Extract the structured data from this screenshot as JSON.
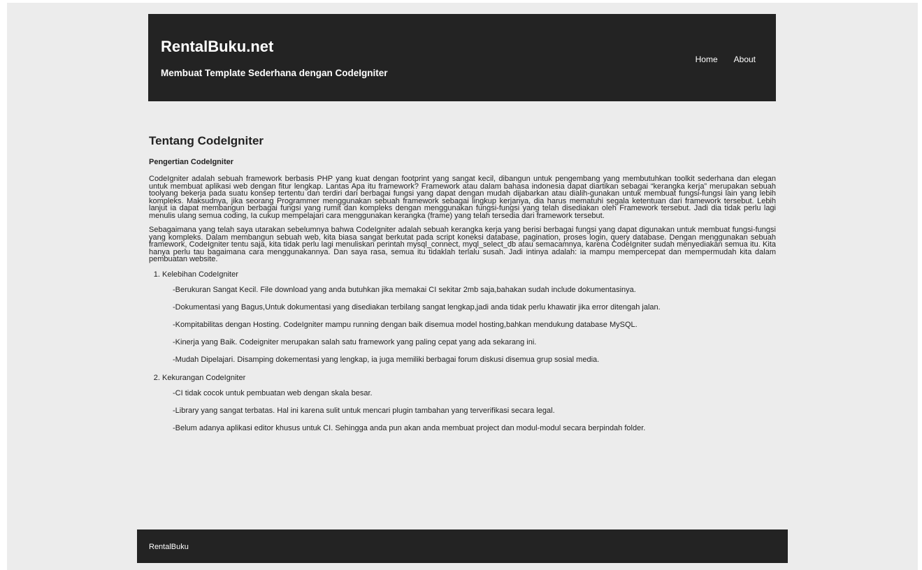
{
  "header": {
    "title": "RentalBuku.net",
    "subtitle": "Membuat Template Sederhana dengan CodeIgniter",
    "nav": [
      "Home",
      "About"
    ]
  },
  "main": {
    "title": "Tentang CodeIgniter",
    "section_title": "Pengertian CodeIgniter",
    "paragraphs": [
      "CodeIgniter adalah sebuah framework berbasis PHP yang kuat dengan footprint yang sangat kecil, dibangun untuk pengembang yang membutuhkan toolkit sederhana dan elegan untuk membuat aplikasi web dengan fitur lengkap. Lantas Apa itu framework? Framework atau dalam bahasa indonesia dapat diartikan sebagai “kerangka kerja” merupakan sebuah toolyang bekerja pada suatu konsep tertentu dan terdiri dari berbagai fungsi yang dapat dengan mudah dijabarkan atau dialih-gunakan untuk membuat fungsi-fungsi lain yang lebih kompleks. Maksudnya, jika seorang Programmer menggunakan sebuah framework sebagai lingkup kerjanya, dia harus mematuhi segala ketentuan dari framework tersebut. Lebih lanjut ia dapat membangun berbagai fungsi yang rumit dan kompleks dengan menggunakan fungsi-fungsi yang telah disediakan oleh Framework tersebut. Jadi dia tidak perlu lagi menulis ulang semua coding, Ia cukup mempelajari cara menggunakan kerangka (frame) yang telah tersedia dari framework tersebut.",
      "Sebagaimana yang telah saya utarakan sebelumnya bahwa CodeIgniter adalah sebuah kerangka kerja yang berisi berbagai fungsi yang dapat digunakan untuk membuat fungsi-fungsi yang kompleks. Dalam membangun sebuah web, kita biasa sangat berkutat pada script koneksi database, pagination, proses login, query database. Dengan menggunakan sebuah framework, CodeIgniter tentu saja, kita tidak perlu lagi menuliskan perintah mysql_connect, myql_select_db atau semacamnya, karena CodeIgniter sudah menyediakan semua itu. Kita hanya perlu tau bagaimana cara menggunakannya. Dan saya rasa, semua itu tidaklah terlalu susah. Jadi intinya adalah: ia mampu mempercepat dan mempermudah kita dalam pembuatan website."
    ],
    "list": [
      {
        "heading": "Kelebihan CodeIgniter",
        "items": [
          "-Berukuran Sangat Kecil. File download yang anda butuhkan jika memakai CI sekitar 2mb saja,bahakan sudah include dokumentasinya.",
          "-Dokumentasi yang Bagus,Untuk dokumentasi yang disediakan terbilang sangat lengkap,jadi anda tidak perlu khawatir jika error ditengah jalan.",
          "-Kompitabilitas dengan Hosting. CodeIgniter mampu running dengan baik disemua model hosting,bahkan mendukung database MySQL.",
          "-Kinerja yang Baik. Codeigniter merupakan salah satu framework yang paling cepat yang ada sekarang ini.",
          "-Mudah Dipelajari. Disamping dokementasi yang lengkap, ia juga memiliki berbagai forum diskusi disemua grup sosial media."
        ]
      },
      {
        "heading": "Kekurangan CodeIgniter",
        "items": [
          "-CI tidak cocok untuk pembuatan web dengan skala besar.",
          "-Library yang sangat terbatas. Hal ini karena sulit untuk mencari plugin tambahan yang terverifikasi secara legal.",
          "-Belum adanya aplikasi editor khusus untuk CI. Sehingga anda pun akan anda membuat project dan modul-modul secara berpindah folder."
        ]
      }
    ]
  },
  "footer": {
    "text": "RentalBuku"
  }
}
